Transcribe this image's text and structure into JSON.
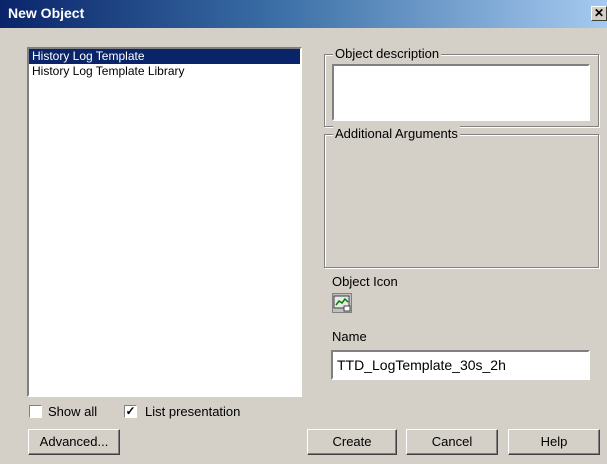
{
  "window": {
    "title": "New Object",
    "close_glyph": "✕"
  },
  "object_list": {
    "items": [
      {
        "label": "History Log Template",
        "selected": true
      },
      {
        "label": "History Log Template Library",
        "selected": false
      }
    ]
  },
  "description_group": {
    "label": "Object description",
    "value": ""
  },
  "arguments_group": {
    "label": "Additional Arguments"
  },
  "object_icon": {
    "label": "Object Icon",
    "icon": "history-log-template-icon"
  },
  "name_field": {
    "label": "Name",
    "value": "TTD_LogTemplate_30s_2h"
  },
  "options": {
    "show_all": {
      "label": "Show all",
      "checked": false
    },
    "list_presentation": {
      "label": "List presentation",
      "checked": true,
      "check_glyph": "✓"
    }
  },
  "buttons": {
    "advanced": "Advanced...",
    "create": "Create",
    "cancel": "Cancel",
    "help": "Help"
  },
  "colors": {
    "selection": "#0a246a",
    "dialog_bg": "#d4d0c8"
  }
}
